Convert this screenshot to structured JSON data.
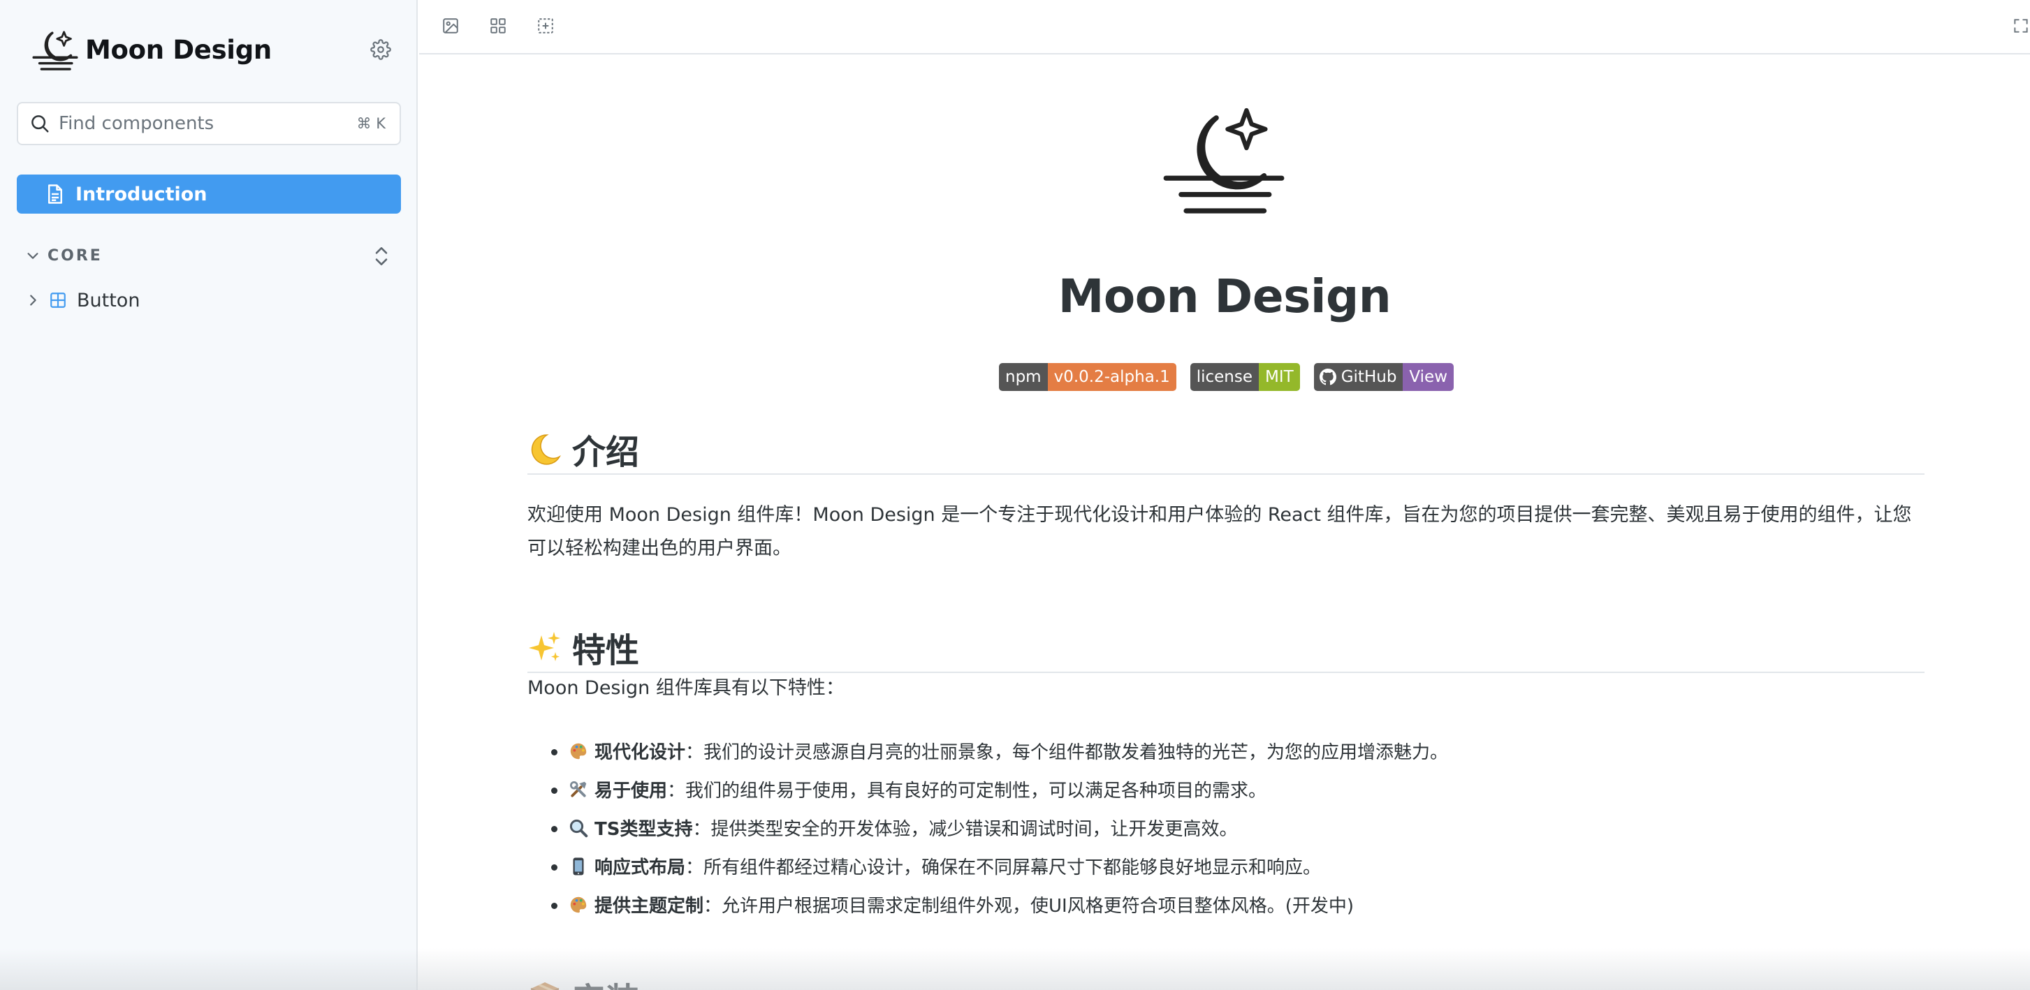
{
  "sidebar": {
    "brand": {
      "name": "Moon Design",
      "logo_icon": "moon-logo-icon"
    },
    "settings_icon": "gear-icon",
    "search": {
      "placeholder": "Find components",
      "shortcut": "⌘ K"
    },
    "nav": [
      {
        "label": "Introduction",
        "icon": "document-icon",
        "active": true
      }
    ],
    "groups": [
      {
        "label": "CORE",
        "expanded": true,
        "items": [
          {
            "label": "Button",
            "icon": "component-icon",
            "expanded": false
          }
        ]
      }
    ]
  },
  "toolbar": {
    "tools": [
      "image-icon",
      "grid-icon",
      "outline-icon"
    ],
    "fullscreen_icon": "fullscreen-icon"
  },
  "doc": {
    "title": "Moon Design",
    "badges": [
      {
        "label": "npm",
        "value": "v0.0.2-alpha.1",
        "color": "#e47d44"
      },
      {
        "label": "license",
        "value": "MIT",
        "color": "#94b82a"
      },
      {
        "label": "GitHub",
        "value": "View",
        "color": "#8a62ae",
        "icon": "github-icon"
      }
    ],
    "sections": {
      "intro": {
        "emoji": "crescent-moon-emoji",
        "heading": "介绍",
        "body": "欢迎使用 Moon Design 组件库！Moon Design 是一个专注于现代化设计和用户体验的 React 组件库，旨在为您的项目提供一套完整、美观且易于使用的组件，让您可以轻松构建出色的用户界面。"
      },
      "features": {
        "emoji": "sparkles-emoji",
        "heading": "特性",
        "lead": "Moon Design 组件库具有以下特性：",
        "items": [
          {
            "icon": "palette-icon",
            "title": "现代化设计",
            "desc": "：我们的设计灵感源自月亮的壮丽景象，每个组件都散发着独特的光芒，为您的应用增添魅力。"
          },
          {
            "icon": "tools-icon",
            "title": "易于使用",
            "desc": "：我们的组件易于使用，具有良好的可定制性，可以满足各种项目的需求。"
          },
          {
            "icon": "magnifier-icon",
            "title": "TS类型支持",
            "desc": "：提供类型安全的开发体验，减少错误和调试时间，让开发更高效。"
          },
          {
            "icon": "mobile-phone-icon",
            "title": "响应式布局",
            "desc": "：所有组件都经过精心设计，确保在不同屏幕尺寸下都能够良好地显示和响应。"
          },
          {
            "icon": "palette-icon",
            "title": "提供主题定制",
            "desc": "：允许用户根据项目需求定制组件外观，使UI风格更符合项目整体风格。(开发中)"
          }
        ]
      },
      "install": {
        "emoji": "package-emoji",
        "heading": "安装"
      }
    }
  },
  "colors": {
    "accent": "#429bf0",
    "moon_fill": "#f3e995",
    "sidebar_bg": "#f6f9fc",
    "text": "#2e3438"
  }
}
